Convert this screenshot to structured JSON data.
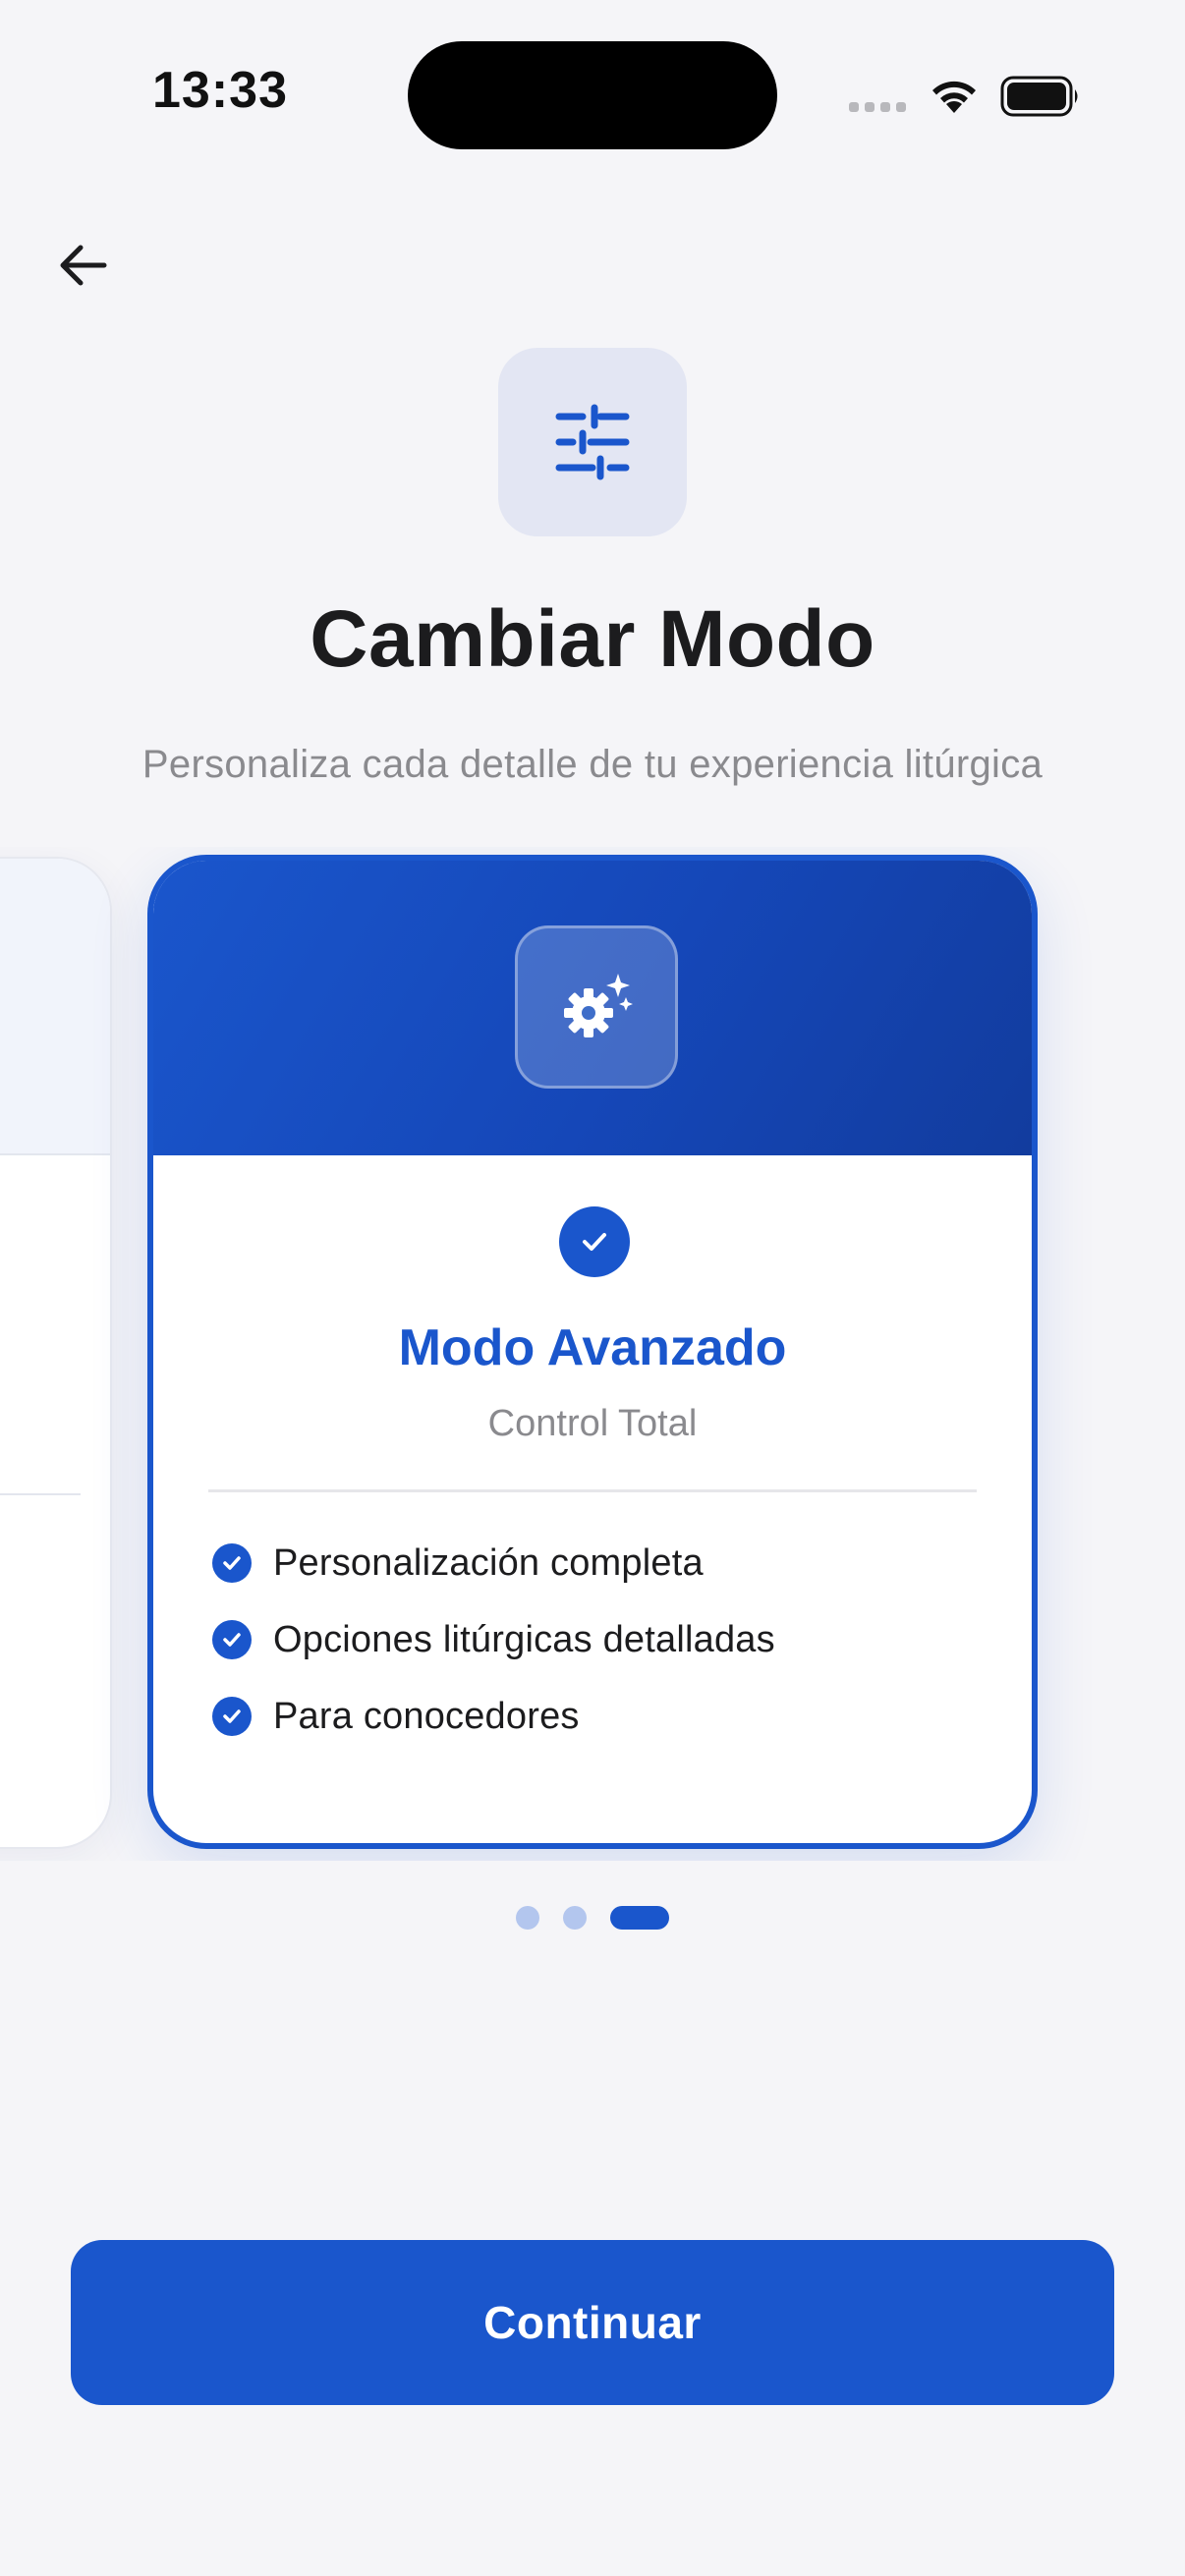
{
  "status_bar": {
    "time": "13:33"
  },
  "header": {
    "icon": "sliders-icon",
    "title": "Cambiar Modo",
    "subtitle": "Personaliza cada detalle de tu experiencia litúrgica"
  },
  "carousel": {
    "active_index": 2,
    "total": 3,
    "active_card": {
      "icon": "gear-sparkle-icon",
      "selected": true,
      "title": "Modo Avanzado",
      "subtitle": "Control Total",
      "features": [
        "Personalización completa",
        "Opciones litúrgicas detalladas",
        "Para conocedores"
      ]
    }
  },
  "footer": {
    "continue_label": "Continuar"
  },
  "colors": {
    "accent": "#1a56cc",
    "background": "#f5f5f8",
    "dot_inactive": "#b3c6ee"
  }
}
